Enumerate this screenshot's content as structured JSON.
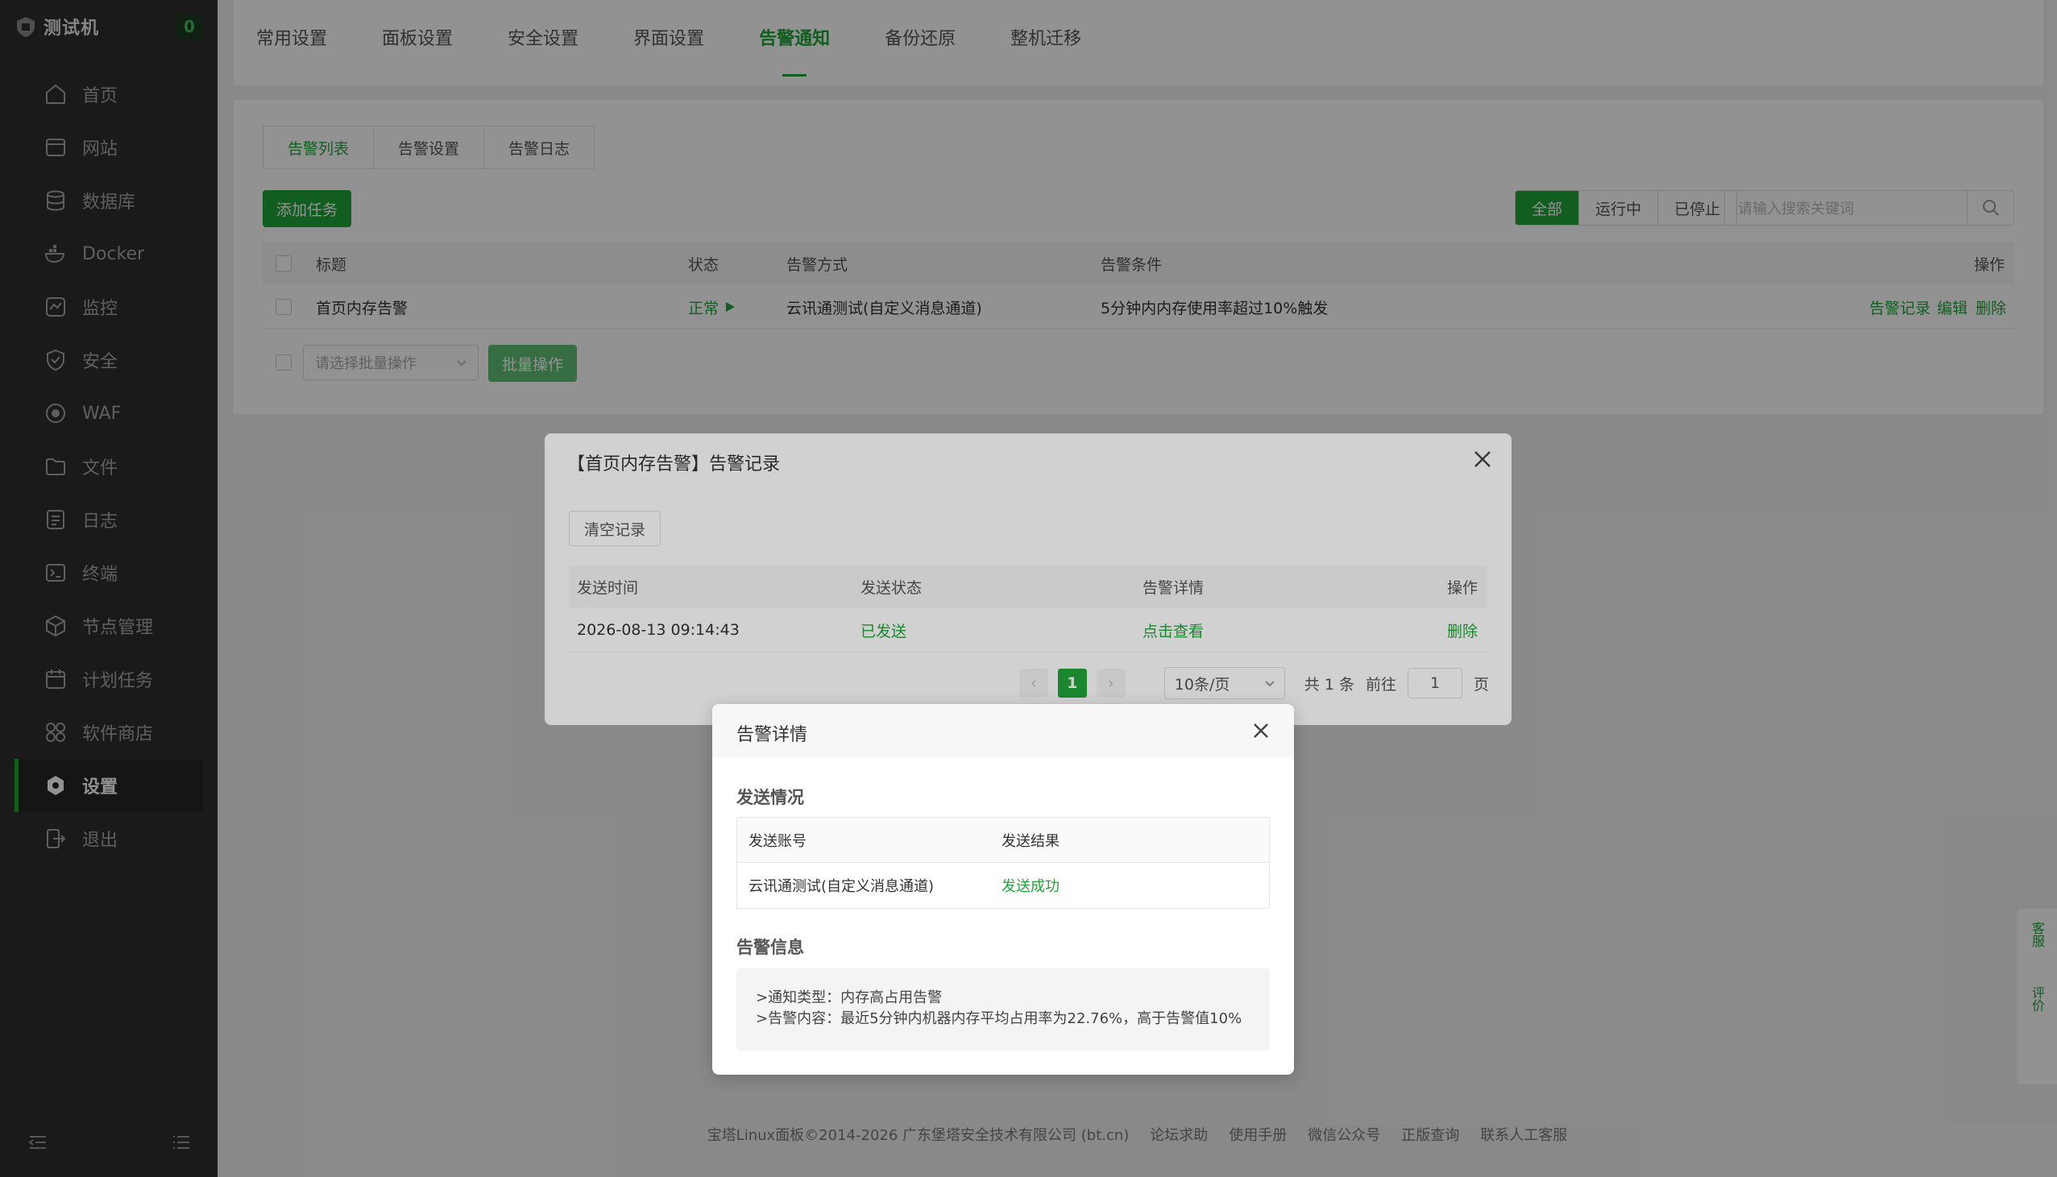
{
  "sidebar": {
    "brand": "测试机",
    "count": "0",
    "items": [
      {
        "label": "首页",
        "icon": "home-icon"
      },
      {
        "label": "网站",
        "icon": "website-icon"
      },
      {
        "label": "数据库",
        "icon": "database-icon"
      },
      {
        "label": "Docker",
        "icon": "docker-icon"
      },
      {
        "label": "监控",
        "icon": "monitor-icon"
      },
      {
        "label": "安全",
        "icon": "shield-icon"
      },
      {
        "label": "WAF",
        "icon": "waf-icon"
      },
      {
        "label": "文件",
        "icon": "folder-icon"
      },
      {
        "label": "日志",
        "icon": "log-icon"
      },
      {
        "label": "终端",
        "icon": "terminal-icon"
      },
      {
        "label": "节点管理",
        "icon": "node-icon"
      },
      {
        "label": "计划任务",
        "icon": "calendar-icon"
      },
      {
        "label": "软件商店",
        "icon": "store-icon"
      },
      {
        "label": "设置",
        "icon": "settings-icon"
      },
      {
        "label": "退出",
        "icon": "logout-icon"
      }
    ],
    "active_index": 13
  },
  "tabs": [
    "常用设置",
    "面板设置",
    "安全设置",
    "界面设置",
    "告警通知",
    "备份还原",
    "整机迁移"
  ],
  "active_tab": "告警通知",
  "subtabs": [
    "告警列表",
    "告警设置",
    "告警日志"
  ],
  "add_task": "添加任务",
  "filters": [
    "全部",
    "运行中",
    "已停止"
  ],
  "search_placeholder": "请输入搜索关键词",
  "table": {
    "headers": {
      "title": "标题",
      "status": "状态",
      "method": "告警方式",
      "condition": "告警条件",
      "ops": "操作"
    },
    "rows": [
      {
        "title": "首页内存告警",
        "status": "正常",
        "method": "云讯通测试(自定义消息通道)",
        "condition": "5分钟内内存使用率超过10%触发",
        "actions": [
          "告警记录",
          "编辑",
          "删除"
        ]
      }
    ]
  },
  "batch": {
    "placeholder": "请选择批量操作",
    "button": "批量操作"
  },
  "record_dialog": {
    "title": "【首页内存告警】告警记录",
    "clear": "清空记录",
    "headers": [
      "发送时间",
      "发送状态",
      "告警详情",
      "操作"
    ],
    "rows": [
      {
        "time": "2026-08-13 09:14:43",
        "status": "已发送",
        "detail": "点击查看",
        "op": "删除"
      }
    ],
    "pager": {
      "page": "1",
      "size": "10条/页",
      "total": "共 1 条",
      "goto": "前往",
      "goto_value": "1",
      "page_unit": "页"
    }
  },
  "detail_dialog": {
    "title": "告警详情",
    "send_section": "发送情况",
    "send_headers": [
      "发送账号",
      "发送结果"
    ],
    "send_row": {
      "account": "云讯通测试(自定义消息通道)",
      "result": "发送成功"
    },
    "info_section": "告警信息",
    "info_lines": [
      ">通知类型：内存高占用告警",
      ">告警内容：最近5分钟内机器内存平均占用率为22.76%，高于告警值10%"
    ]
  },
  "footer": {
    "copyright": "宝塔Linux面板©2014-2026 广东堡塔安全技术有限公司 (bt.cn)",
    "links": [
      "论坛求助",
      "使用手册",
      "微信公众号",
      "正版查询",
      "联系人工客服"
    ]
  },
  "float_tools": [
    "客服",
    "评价"
  ]
}
